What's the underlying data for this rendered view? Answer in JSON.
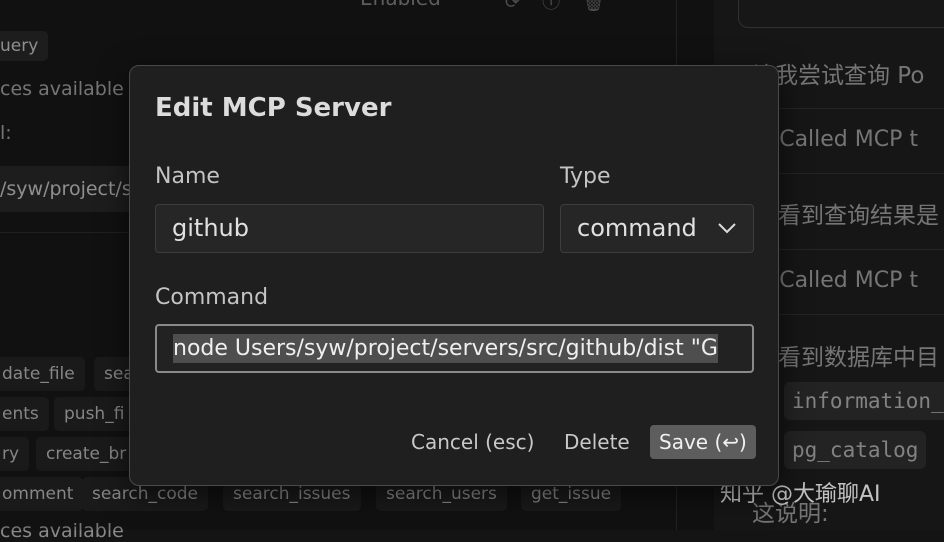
{
  "background": {
    "header_fragment": "Enabled",
    "header_icons": [
      "refresh-icon",
      "info-icon",
      "trash-icon"
    ],
    "query_chip": "uery",
    "resources_text": "ces available",
    "label_fragment": "l:",
    "path_fragment": "/syw/project/s",
    "tool_chips_row1": [
      "date_file",
      "sea"
    ],
    "tool_chips_row2": [
      "ents",
      "push_fi"
    ],
    "tool_chips_row3": [
      "ry",
      "create_br"
    ],
    "tool_chips_row4": [
      "omment",
      "search_code",
      "search_issues",
      "search_users",
      "get_issue"
    ],
    "bottom_fragment": "ces available"
  },
  "chat": {
    "line1": "让我尝试查询 Po",
    "called1": "Called MCP t",
    "line2": "看到查询结果是",
    "called2": "Called MCP t",
    "line3": "看到数据库中目",
    "code1": "information_",
    "code2": "pg_catalog",
    "line4": "这说明:"
  },
  "watermark": "知乎 @大瑜聊AI",
  "modal": {
    "title": "Edit MCP Server",
    "name_label": "Name",
    "name_value": "github",
    "type_label": "Type",
    "type_value": "command",
    "command_label": "Command",
    "command_value": "node Users/syw/project/servers/src/github/dist \"G",
    "cancel_label": "Cancel (esc)",
    "delete_label": "Delete",
    "save_label": "Save (↩)"
  }
}
